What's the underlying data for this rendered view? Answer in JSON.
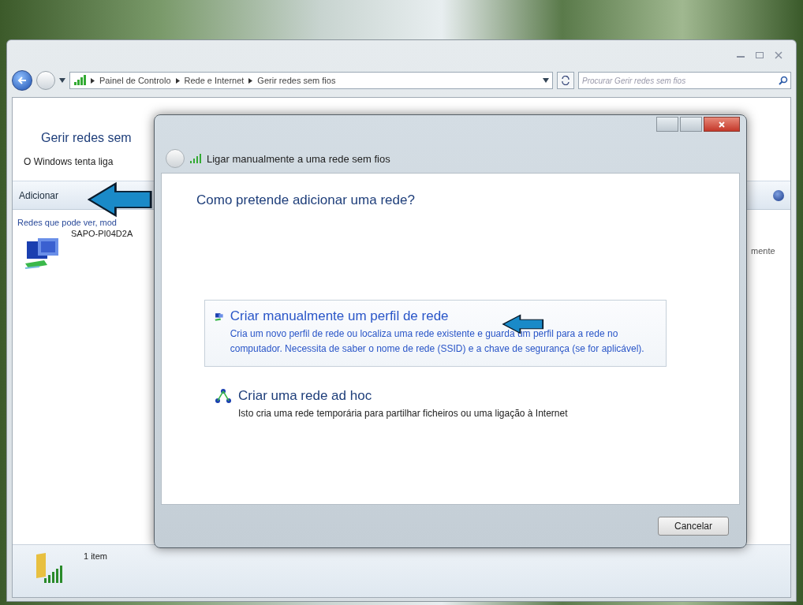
{
  "explorer": {
    "breadcrumb": [
      "Painel de Controlo",
      "Rede e Internet",
      "Gerir redes sem fios"
    ],
    "search": {
      "placeholder": "Procurar Gerir redes sem fios"
    },
    "heading": "Gerir redes sem",
    "description": "O Windows tenta liga",
    "toolbar": [
      "Adicionar"
    ],
    "list_caption": "Redes que pode ver, mod",
    "networks": [
      {
        "name": "SAPO-PI04D2A",
        "column_2": "mente"
      }
    ],
    "status": "1 item"
  },
  "dialog": {
    "title": "Ligar manualmente a uma rede sem fios",
    "question": "Como pretende adicionar uma rede?",
    "options": [
      {
        "kind": "profile",
        "title": "Criar manualmente um perfil de rede",
        "description": "Cria um novo perfil de rede ou localiza uma rede existente e guarda um perfil para a rede no computador. Necessita de saber o nome de rede (SSID) e a chave de segurança (se for aplicável).",
        "selected": true
      },
      {
        "kind": "adhoc",
        "title": "Criar uma rede ad hoc",
        "description": "Isto cria uma rede temporária para partilhar ficheiros ou uma ligação à Internet",
        "selected": false
      }
    ],
    "buttons": [
      "Cancelar"
    ]
  }
}
